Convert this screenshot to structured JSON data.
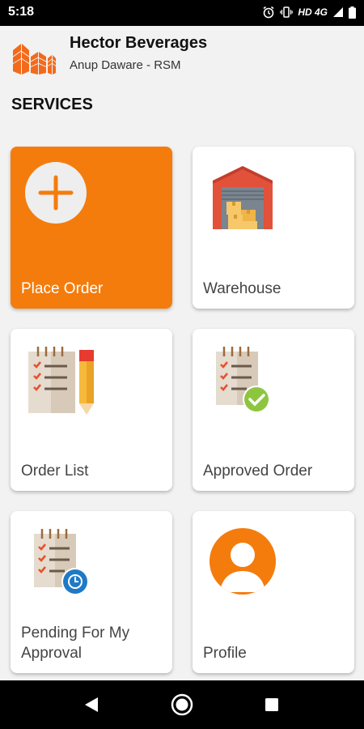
{
  "status": {
    "time": "5:18",
    "network": "HD 4G"
  },
  "header": {
    "company": "Hector Beverages",
    "user": "Anup Daware - RSM"
  },
  "section": {
    "title": "SERVICES"
  },
  "services": [
    {
      "label": "Place Order"
    },
    {
      "label": "Warehouse"
    },
    {
      "label": "Order List"
    },
    {
      "label": "Approved Order"
    },
    {
      "label": "Pending For My Approval"
    },
    {
      "label": "Profile"
    }
  ],
  "colors": {
    "accent": "#f47c0c",
    "background": "#f2f2f2"
  }
}
